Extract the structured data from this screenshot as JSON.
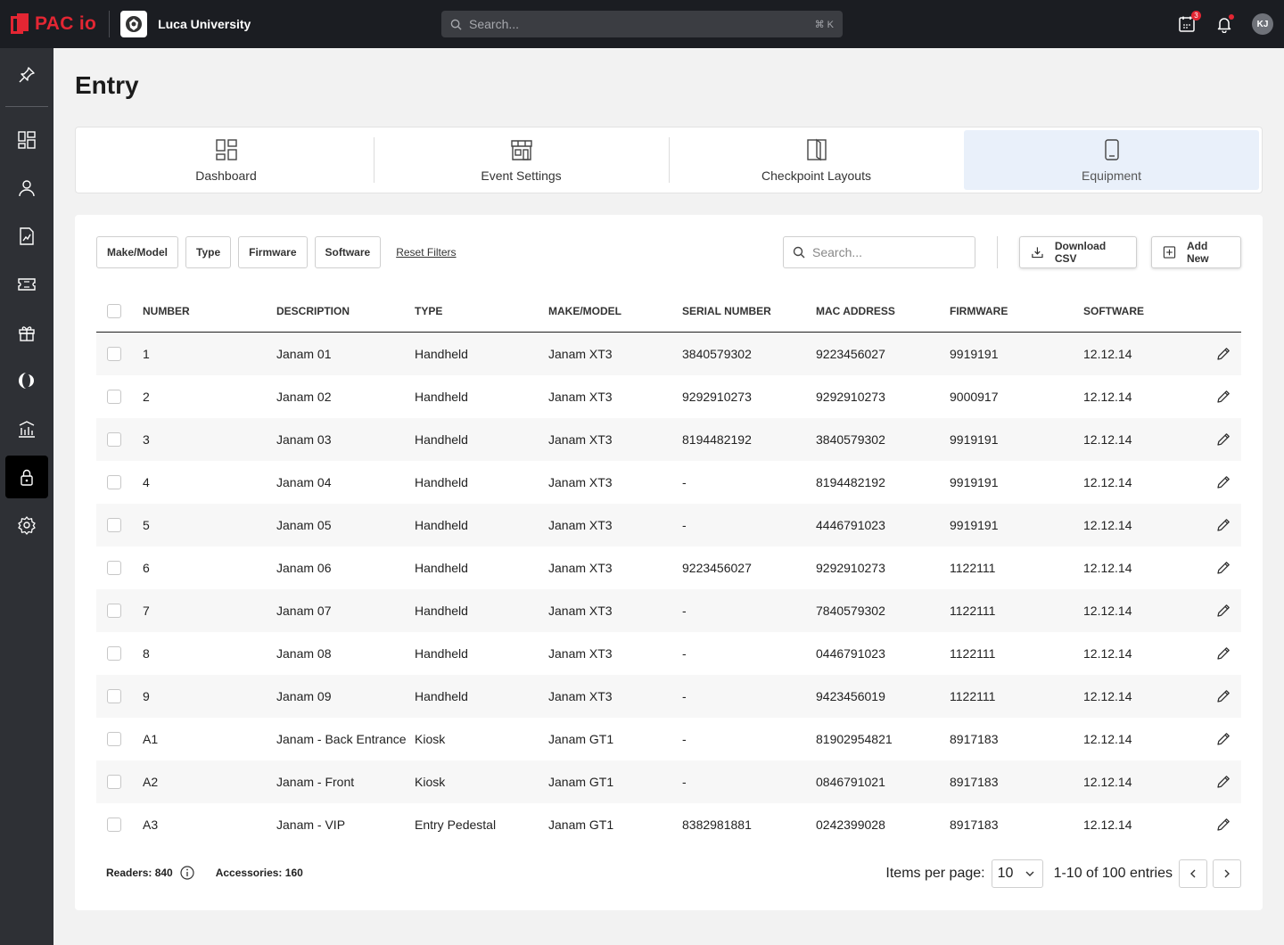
{
  "topbar": {
    "brand": "PAC io",
    "university": "Luca University",
    "search_placeholder": "Search...",
    "shortcut": "⌘ K",
    "calendar_badge": "3",
    "avatar_initials": "KJ"
  },
  "page": {
    "title": "Entry"
  },
  "tabs": [
    {
      "label": "Dashboard"
    },
    {
      "label": "Event Settings"
    },
    {
      "label": "Checkpoint Layouts"
    },
    {
      "label": "Equipment",
      "active": true
    }
  ],
  "filters": {
    "make_model": "Make/Model",
    "type": "Type",
    "firmware": "Firmware",
    "software": "Software",
    "reset": "Reset Filters"
  },
  "search": {
    "placeholder": "Search..."
  },
  "actions": {
    "download_csv": "Download CSV",
    "add_new": "Add New"
  },
  "table": {
    "headers": {
      "number": "NUMBER",
      "description": "DESCRIPTION",
      "type": "TYPE",
      "make_model": "MAKE/MODEL",
      "serial": "SERIAL NUMBER",
      "mac": "MAC ADDRESS",
      "firmware": "FIRMWARE",
      "software": "SOFTWARE"
    },
    "rows": [
      [
        "1",
        "Janam 01",
        "Handheld",
        "Janam XT3",
        "3840579302",
        "9223456027",
        "9919191",
        "12.12.14"
      ],
      [
        "2",
        "Janam 02",
        "Handheld",
        "Janam XT3",
        "9292910273",
        "9292910273",
        "9000917",
        "12.12.14"
      ],
      [
        "3",
        "Janam 03",
        "Handheld",
        "Janam XT3",
        "8194482192",
        "3840579302",
        "9919191",
        "12.12.14"
      ],
      [
        "4",
        "Janam 04",
        "Handheld",
        "Janam XT3",
        "-",
        "8194482192",
        "9919191",
        "12.12.14"
      ],
      [
        "5",
        "Janam 05",
        "Handheld",
        "Janam XT3",
        "-",
        "4446791023",
        "9919191",
        "12.12.14"
      ],
      [
        "6",
        "Janam 06",
        "Handheld",
        "Janam XT3",
        "9223456027",
        "9292910273",
        "1122111",
        "12.12.14"
      ],
      [
        "7",
        "Janam 07",
        "Handheld",
        "Janam XT3",
        "-",
        "7840579302",
        "1122111",
        "12.12.14"
      ],
      [
        "8",
        "Janam 08",
        "Handheld",
        "Janam XT3",
        "-",
        "0446791023",
        "1122111",
        "12.12.14"
      ],
      [
        "9",
        "Janam 09",
        "Handheld",
        "Janam XT3",
        "-",
        "9423456019",
        "1122111",
        "12.12.14"
      ],
      [
        "A1",
        "Janam - Back Entrance",
        "Kiosk",
        "Janam GT1",
        "-",
        "81902954821",
        "8917183",
        "12.12.14"
      ],
      [
        "A2",
        "Janam - Front",
        "Kiosk",
        "Janam GT1",
        "-",
        "0846791021",
        "8917183",
        "12.12.14"
      ],
      [
        "A3",
        "Janam - VIP",
        "Entry Pedestal",
        "Janam GT1",
        "8382981881",
        "0242399028",
        "8917183",
        "12.12.14"
      ]
    ]
  },
  "footer": {
    "readers": "Readers: 840",
    "accessories": "Accessories: 160",
    "items_per_page_label": "Items per page:",
    "items_per_page": "10",
    "range": "1-10 of 100 entries"
  }
}
